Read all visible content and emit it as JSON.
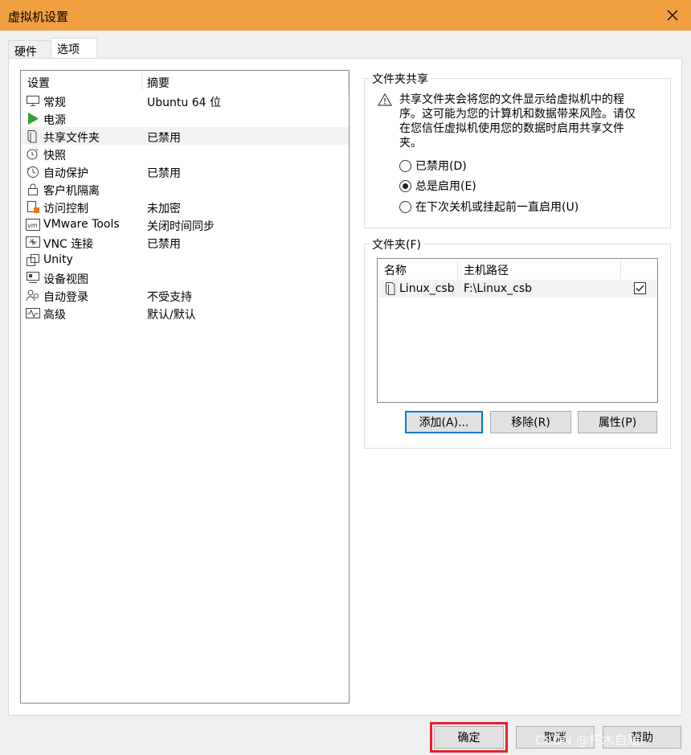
{
  "window": {
    "title": "虚拟机设置"
  },
  "tabs": [
    {
      "label": "硬件"
    },
    {
      "label": "选项"
    }
  ],
  "settings_list": {
    "col_setting": "设置",
    "col_summary": "摘要",
    "items": [
      {
        "name": "常规",
        "summary": "Ubuntu 64 位",
        "icon": "monitor-icon"
      },
      {
        "name": "电源",
        "summary": "",
        "icon": "play-icon"
      },
      {
        "name": "共享文件夹",
        "summary": "已禁用",
        "icon": "shared-folder-icon"
      },
      {
        "name": "快照",
        "summary": "",
        "icon": "snapshot-icon"
      },
      {
        "name": "自动保护",
        "summary": "已禁用",
        "icon": "clock-icon"
      },
      {
        "name": "客户机隔离",
        "summary": "",
        "icon": "lock-icon"
      },
      {
        "name": "访问控制",
        "summary": "未加密",
        "icon": "access-control-icon"
      },
      {
        "name": "VMware Tools",
        "summary": "关闭时间同步",
        "icon": "vm-icon"
      },
      {
        "name": "VNC 连接",
        "summary": "已禁用",
        "icon": "network-icon"
      },
      {
        "name": "Unity",
        "summary": "",
        "icon": "unity-icon"
      },
      {
        "name": "设备视图",
        "summary": "",
        "icon": "device-view-icon"
      },
      {
        "name": "自动登录",
        "summary": "不受支持",
        "icon": "users-icon"
      },
      {
        "name": "高级",
        "summary": "默认/默认",
        "icon": "advanced-icon"
      }
    ]
  },
  "sharing": {
    "legend": "文件夹共享",
    "warning": "共享文件夹会将您的文件显示给虚拟机中的程序。这可能为您的计算机和数据带来风险。请仅在您信任虚拟机使用您的数据时启用共享文件夹。",
    "options": [
      {
        "label": "已禁用(D)",
        "selected": false
      },
      {
        "label": "总是启用(E)",
        "selected": true
      },
      {
        "label": "在下次关机或挂起前一直启用(U)",
        "selected": false
      }
    ]
  },
  "folders": {
    "legend": "文件夹(F)",
    "col_name": "名称",
    "col_path": "主机路径",
    "rows": [
      {
        "name": "Linux_csb",
        "path": "F:\\Linux_csb",
        "enabled": true
      }
    ],
    "add_label": "添加(A)...",
    "remove_label": "移除(R)",
    "properties_label": "属性(P)"
  },
  "footer": {
    "ok_label": "确定",
    "cancel_label": "取消",
    "help_label": "帮助"
  },
  "watermark": "CSDN @朽木自雕i",
  "colors": {
    "titlebar": "#f0a040",
    "highlight": "#e8202a",
    "play_green": "#2fa32f"
  }
}
